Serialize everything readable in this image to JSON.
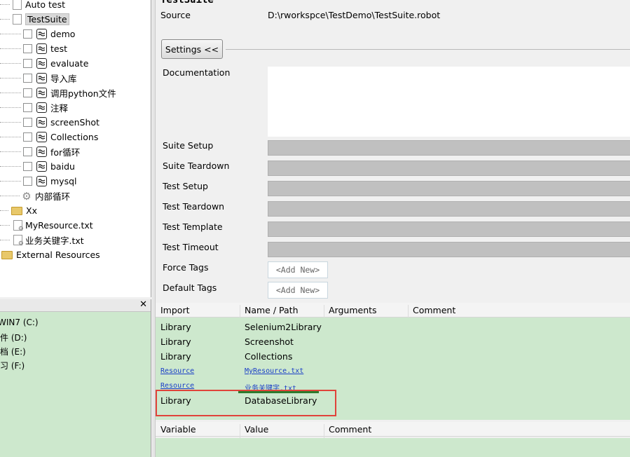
{
  "tree": {
    "items": [
      {
        "label": "Auto test",
        "icon": "doc"
      },
      {
        "label": "TestSuite",
        "icon": "doc",
        "selected": true
      },
      {
        "label": "demo",
        "icon": "keyword"
      },
      {
        "label": "test",
        "icon": "keyword"
      },
      {
        "label": "evaluate",
        "icon": "keyword"
      },
      {
        "label": "导入库",
        "icon": "keyword"
      },
      {
        "label": "调用python文件",
        "icon": "keyword"
      },
      {
        "label": "注释",
        "icon": "keyword"
      },
      {
        "label": "screenShot",
        "icon": "keyword"
      },
      {
        "label": "Collections",
        "icon": "keyword"
      },
      {
        "label": "for循环",
        "icon": "keyword"
      },
      {
        "label": "baidu",
        "icon": "keyword"
      },
      {
        "label": "mysql",
        "icon": "keyword"
      },
      {
        "label": "内部循环",
        "icon": "gear"
      },
      {
        "label": "Xx",
        "icon": "folder"
      },
      {
        "label": "MyResource.txt",
        "icon": "resource-file"
      },
      {
        "label": "业务关键字.txt",
        "icon": "resource-file"
      },
      {
        "label": "External Resources",
        "icon": "folder"
      }
    ]
  },
  "explorer": {
    "close": "✕",
    "drives": [
      "WIN7 (C:)",
      "软件 (D:)",
      "文档 (E:)",
      "学习 (F:)"
    ]
  },
  "suite": {
    "title": "TestSuite",
    "source_label": "Source",
    "source_value": "D:\\rworkspce\\TestDemo\\TestSuite.robot",
    "settings_button": "Settings <<",
    "fields": {
      "documentation": "Documentation",
      "suite_setup": "Suite Setup",
      "suite_teardown": "Suite Teardown",
      "test_setup": "Test Setup",
      "test_teardown": "Test Teardown",
      "test_template": "Test Template",
      "test_timeout": "Test Timeout",
      "force_tags": "Force Tags",
      "default_tags": "Default Tags"
    },
    "add_new": "<Add New>"
  },
  "imports": {
    "headers": [
      "Import",
      "Name / Path",
      "Arguments",
      "Comment"
    ],
    "rows": [
      {
        "type": "Library",
        "name": "Selenium2Library",
        "link": false
      },
      {
        "type": "Library",
        "name": "Screenshot",
        "link": false
      },
      {
        "type": "Library",
        "name": "Collections",
        "link": false
      },
      {
        "type": "Resource",
        "name": "MyResource.txt",
        "link": true
      },
      {
        "type": "Resource",
        "name": "业务关键字.txt",
        "link": true
      },
      {
        "type": "Library",
        "name": "DatabaseLibrary",
        "link": false
      }
    ]
  },
  "variables": {
    "headers": [
      "Variable",
      "Value",
      "Comment"
    ]
  },
  "colors": {
    "green_table": "#cde8cd",
    "highlight_red": "#e0433a",
    "link_blue": "#1a3ec7"
  }
}
